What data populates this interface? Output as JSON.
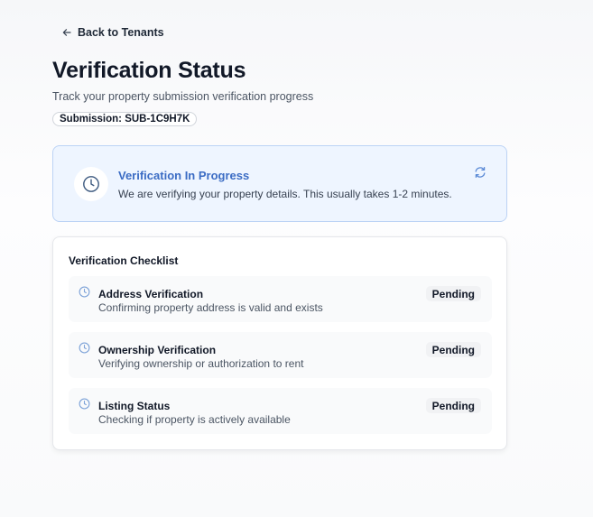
{
  "nav": {
    "back_label": "Back to Tenants",
    "back_icon": "arrow-left-icon"
  },
  "header": {
    "title": "Verification Status",
    "subtitle": "Track your property submission verification progress",
    "submission_chip": "Submission: SUB-1C9H7K"
  },
  "status": {
    "title": "Verification In Progress",
    "description": "We are verifying your property details. This usually takes 1-2 minutes.",
    "icon": "clock-icon",
    "action_icon": "refresh-icon",
    "accent_color": "#3b6cc4"
  },
  "checklist": {
    "title": "Verification Checklist",
    "items": [
      {
        "title": "Address Verification",
        "description": "Confirming property address is valid and exists",
        "status": "Pending",
        "icon": "clock-icon"
      },
      {
        "title": "Ownership Verification",
        "description": "Verifying ownership or authorization to rent",
        "status": "Pending",
        "icon": "clock-icon"
      },
      {
        "title": "Listing Status",
        "description": "Checking if property is actively available",
        "status": "Pending",
        "icon": "clock-icon"
      }
    ]
  }
}
